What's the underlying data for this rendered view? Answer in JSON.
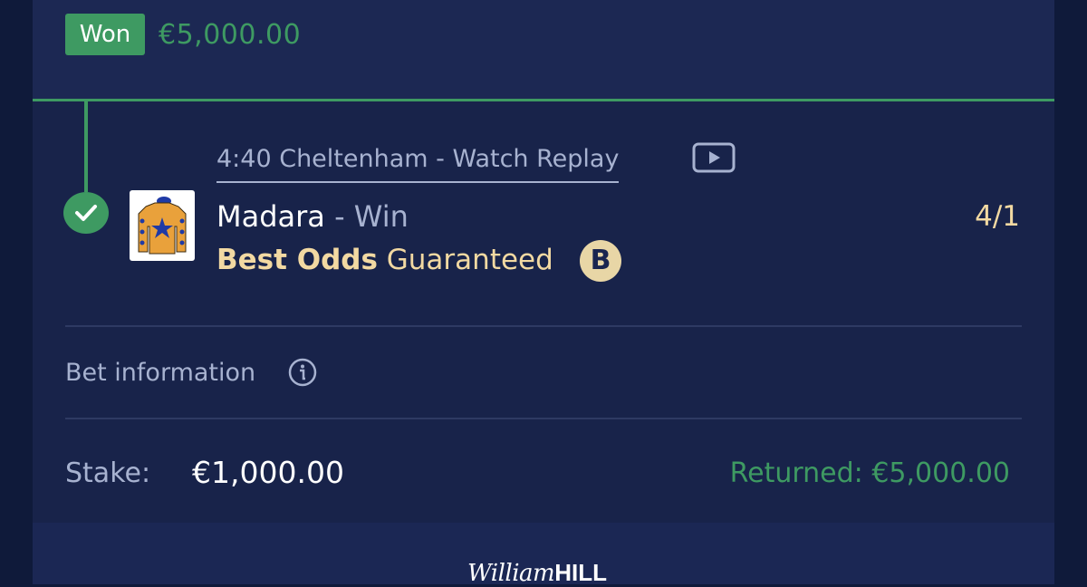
{
  "header": {
    "status": "Won",
    "amount": "€5,000.00"
  },
  "selection": {
    "race_link": "4:40 Cheltenham - Watch Replay",
    "horse": "Madara",
    "separator": "-",
    "market": "Win",
    "odds": "4/1",
    "boost_bold": "Best Odds",
    "boost_text": "Guaranteed",
    "boost_badge": "B"
  },
  "bet_info": {
    "label": "Bet information"
  },
  "summary": {
    "stake_label": "Stake:",
    "stake_value": "€1,000.00",
    "returned": "Returned: €5,000.00"
  },
  "footer": {
    "brand_script": "William",
    "brand_bold": "HILL"
  },
  "colors": {
    "win_green": "#3e9a62",
    "card_bg": "#18234a",
    "gold": "#f2d9a2"
  },
  "icons": [
    "check-icon",
    "play-icon",
    "jockey-silks-icon",
    "info-icon"
  ]
}
